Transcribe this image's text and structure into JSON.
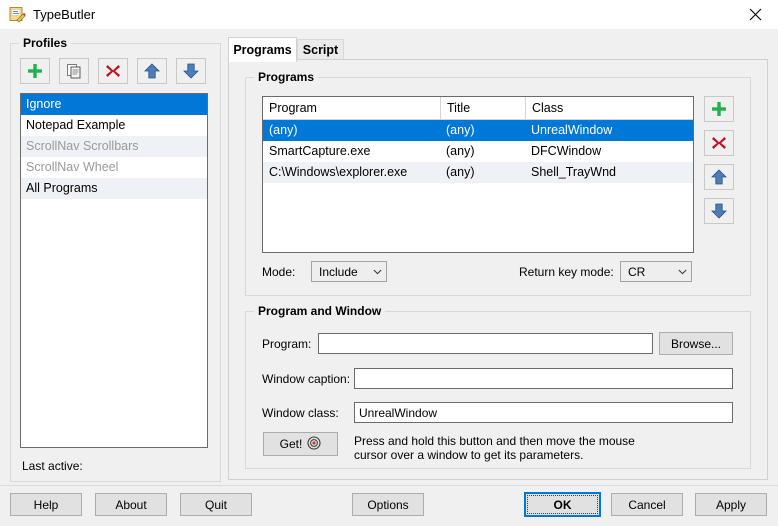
{
  "window": {
    "title": "TypeButler",
    "icon": "app-icon",
    "close_icon": "close-icon"
  },
  "profiles": {
    "group_label": "Profiles",
    "toolbar": [
      {
        "name": "add-profile-button",
        "icon": "plus-icon"
      },
      {
        "name": "copy-profile-button",
        "icon": "copy-icon"
      },
      {
        "name": "delete-profile-button",
        "icon": "delete-x-icon"
      },
      {
        "name": "move-profile-up-button",
        "icon": "arrow-up-icon"
      },
      {
        "name": "move-profile-down-button",
        "icon": "arrow-down-icon"
      }
    ],
    "items": [
      {
        "label": "Ignore",
        "selected": true,
        "disabled": false
      },
      {
        "label": "Notepad Example",
        "selected": false,
        "disabled": false
      },
      {
        "label": "ScrollNav Scrollbars",
        "selected": false,
        "disabled": true
      },
      {
        "label": "ScrollNav Wheel",
        "selected": false,
        "disabled": true
      },
      {
        "label": "All Programs",
        "selected": false,
        "disabled": false
      }
    ],
    "last_active_label": "Last active:",
    "last_active_value": ""
  },
  "tabs": [
    {
      "label": "Programs",
      "active": true
    },
    {
      "label": "Script",
      "active": false
    }
  ],
  "programs_panel": {
    "group_label": "Programs",
    "columns": [
      "Program",
      "Title",
      "Class"
    ],
    "rows": [
      {
        "program": "(any)",
        "title": "(any)",
        "class": "UnrealWindow",
        "selected": true
      },
      {
        "program": "SmartCapture.exe",
        "title": "(any)",
        "class": "DFCWindow",
        "selected": false
      },
      {
        "program": "C:\\Windows\\explorer.exe",
        "title": "(any)",
        "class": "Shell_TrayWnd",
        "selected": false
      }
    ],
    "side_buttons": [
      {
        "name": "add-program-button",
        "icon": "plus-icon"
      },
      {
        "name": "delete-program-button",
        "icon": "delete-x-icon"
      },
      {
        "name": "move-program-up-button",
        "icon": "arrow-up-icon"
      },
      {
        "name": "move-program-down-button",
        "icon": "arrow-down-icon"
      }
    ],
    "mode_label": "Mode:",
    "mode_value": "Include",
    "return_key_label": "Return key mode:",
    "return_key_value": "CR"
  },
  "program_window_panel": {
    "group_label": "Program and Window",
    "program_label": "Program:",
    "program_value": "",
    "program_placeholder": "",
    "browse_label": "Browse...",
    "caption_label": "Window caption:",
    "caption_value": "",
    "caption_placeholder": "",
    "class_label": "Window class:",
    "class_value": "UnrealWindow",
    "class_placeholder": "",
    "get_label": "Get!",
    "get_icon": "target-icon",
    "hint_line1": "Press and hold this button and then move the mouse",
    "hint_line2": "cursor over a window to get its parameters."
  },
  "footer": {
    "help_label": "Help",
    "about_label": "About",
    "quit_label": "Quit",
    "options_label": "Options",
    "ok_label": "OK",
    "cancel_label": "Cancel",
    "apply_label": "Apply"
  },
  "colors": {
    "accent": "#0078d7",
    "window_bg": "#f0f0f0",
    "field_bg": "#ffffff",
    "disabled_text": "#9a9a9a",
    "alt_row": "#eef1f5"
  }
}
